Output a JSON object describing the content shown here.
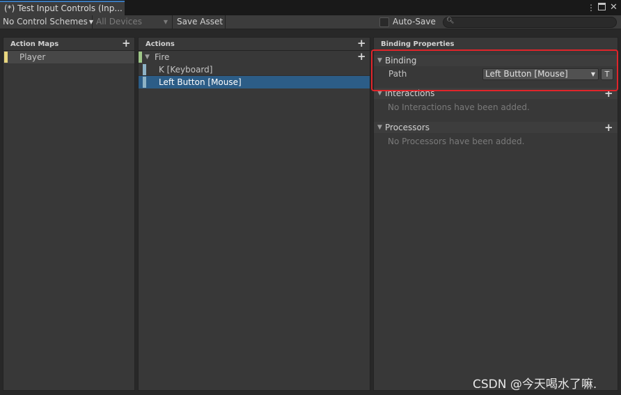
{
  "window": {
    "tab_title": "(*) Test Input Controls (Inp...",
    "icons": [
      "more-vert-icon",
      "maximize-icon",
      "close-icon"
    ]
  },
  "toolbar": {
    "control_schemes": "No Control Schemes",
    "devices": "All Devices",
    "save_asset": "Save Asset",
    "auto_save_label": "Auto-Save",
    "auto_save_checked": false,
    "search_value": ""
  },
  "action_maps": {
    "header": "Action Maps",
    "items": [
      {
        "label": "Player",
        "color": "#e8d67f"
      }
    ]
  },
  "actions": {
    "header": "Actions",
    "action": {
      "label": "Fire",
      "color": "#9ec788"
    },
    "bindings": [
      {
        "label": "K [Keyboard]",
        "selected": false,
        "color": "#8db2c5"
      },
      {
        "label": "Left Button [Mouse]",
        "selected": true,
        "color": "#8db2c5"
      }
    ]
  },
  "binding_properties": {
    "header": "Binding Properties",
    "binding_section": "Binding",
    "path_label": "Path",
    "path_value": "Left Button [Mouse]",
    "path_t_button": "T",
    "interactions_section": "Interactions",
    "interactions_empty": "No Interactions have been added.",
    "processors_section": "Processors",
    "processors_empty": "No Processors have been added."
  },
  "colors": {
    "selection": "#2c5d87",
    "highlight": "#e0242a",
    "tab_accent": "#3a79bb"
  },
  "watermark": "CSDN @今天喝水了嘛."
}
